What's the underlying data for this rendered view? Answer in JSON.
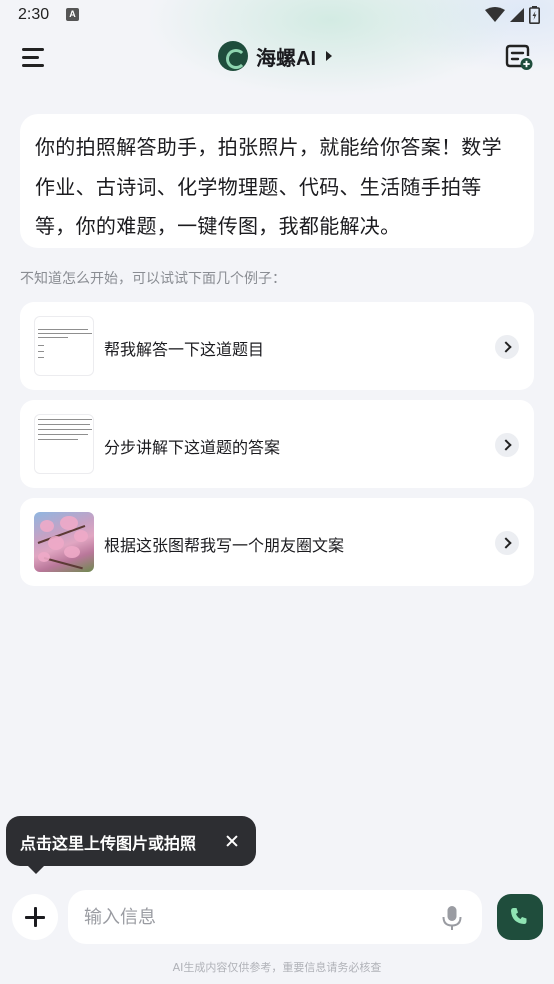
{
  "status_bar": {
    "time": "2:30",
    "notification_badge": "A"
  },
  "header": {
    "title": "海螺AI"
  },
  "intro": {
    "text": "你的拍照解答助手，拍张照片，就能给你答案！数学作业、古诗词、化学物理题、代码、生活随手拍等等，你的难题，一键传图，我都能解决。"
  },
  "hint": "不知道怎么开始，可以试试下面几个例子：",
  "examples": [
    {
      "label": "帮我解答一下这道题目"
    },
    {
      "label": "分步讲解下这道题的答案"
    },
    {
      "label": "根据这张图帮我写一个朋友圈文案"
    }
  ],
  "tooltip": {
    "text": "点击这里上传图片或拍照"
  },
  "input": {
    "placeholder": "输入信息"
  },
  "footer": {
    "disclaimer": "AI生成内容仅供参考，重要信息请务必核查"
  },
  "colors": {
    "brand": "#1f4d3c",
    "background": "#f3f4f8",
    "tooltip": "#2d2e32"
  },
  "icons": [
    "menu-icon",
    "logo-icon",
    "caret-right-icon",
    "new-chat-icon",
    "chevron-right-icon",
    "close-icon",
    "plus-icon",
    "mic-icon",
    "phone-icon",
    "wifi-icon",
    "signal-icon",
    "battery-icon"
  ]
}
